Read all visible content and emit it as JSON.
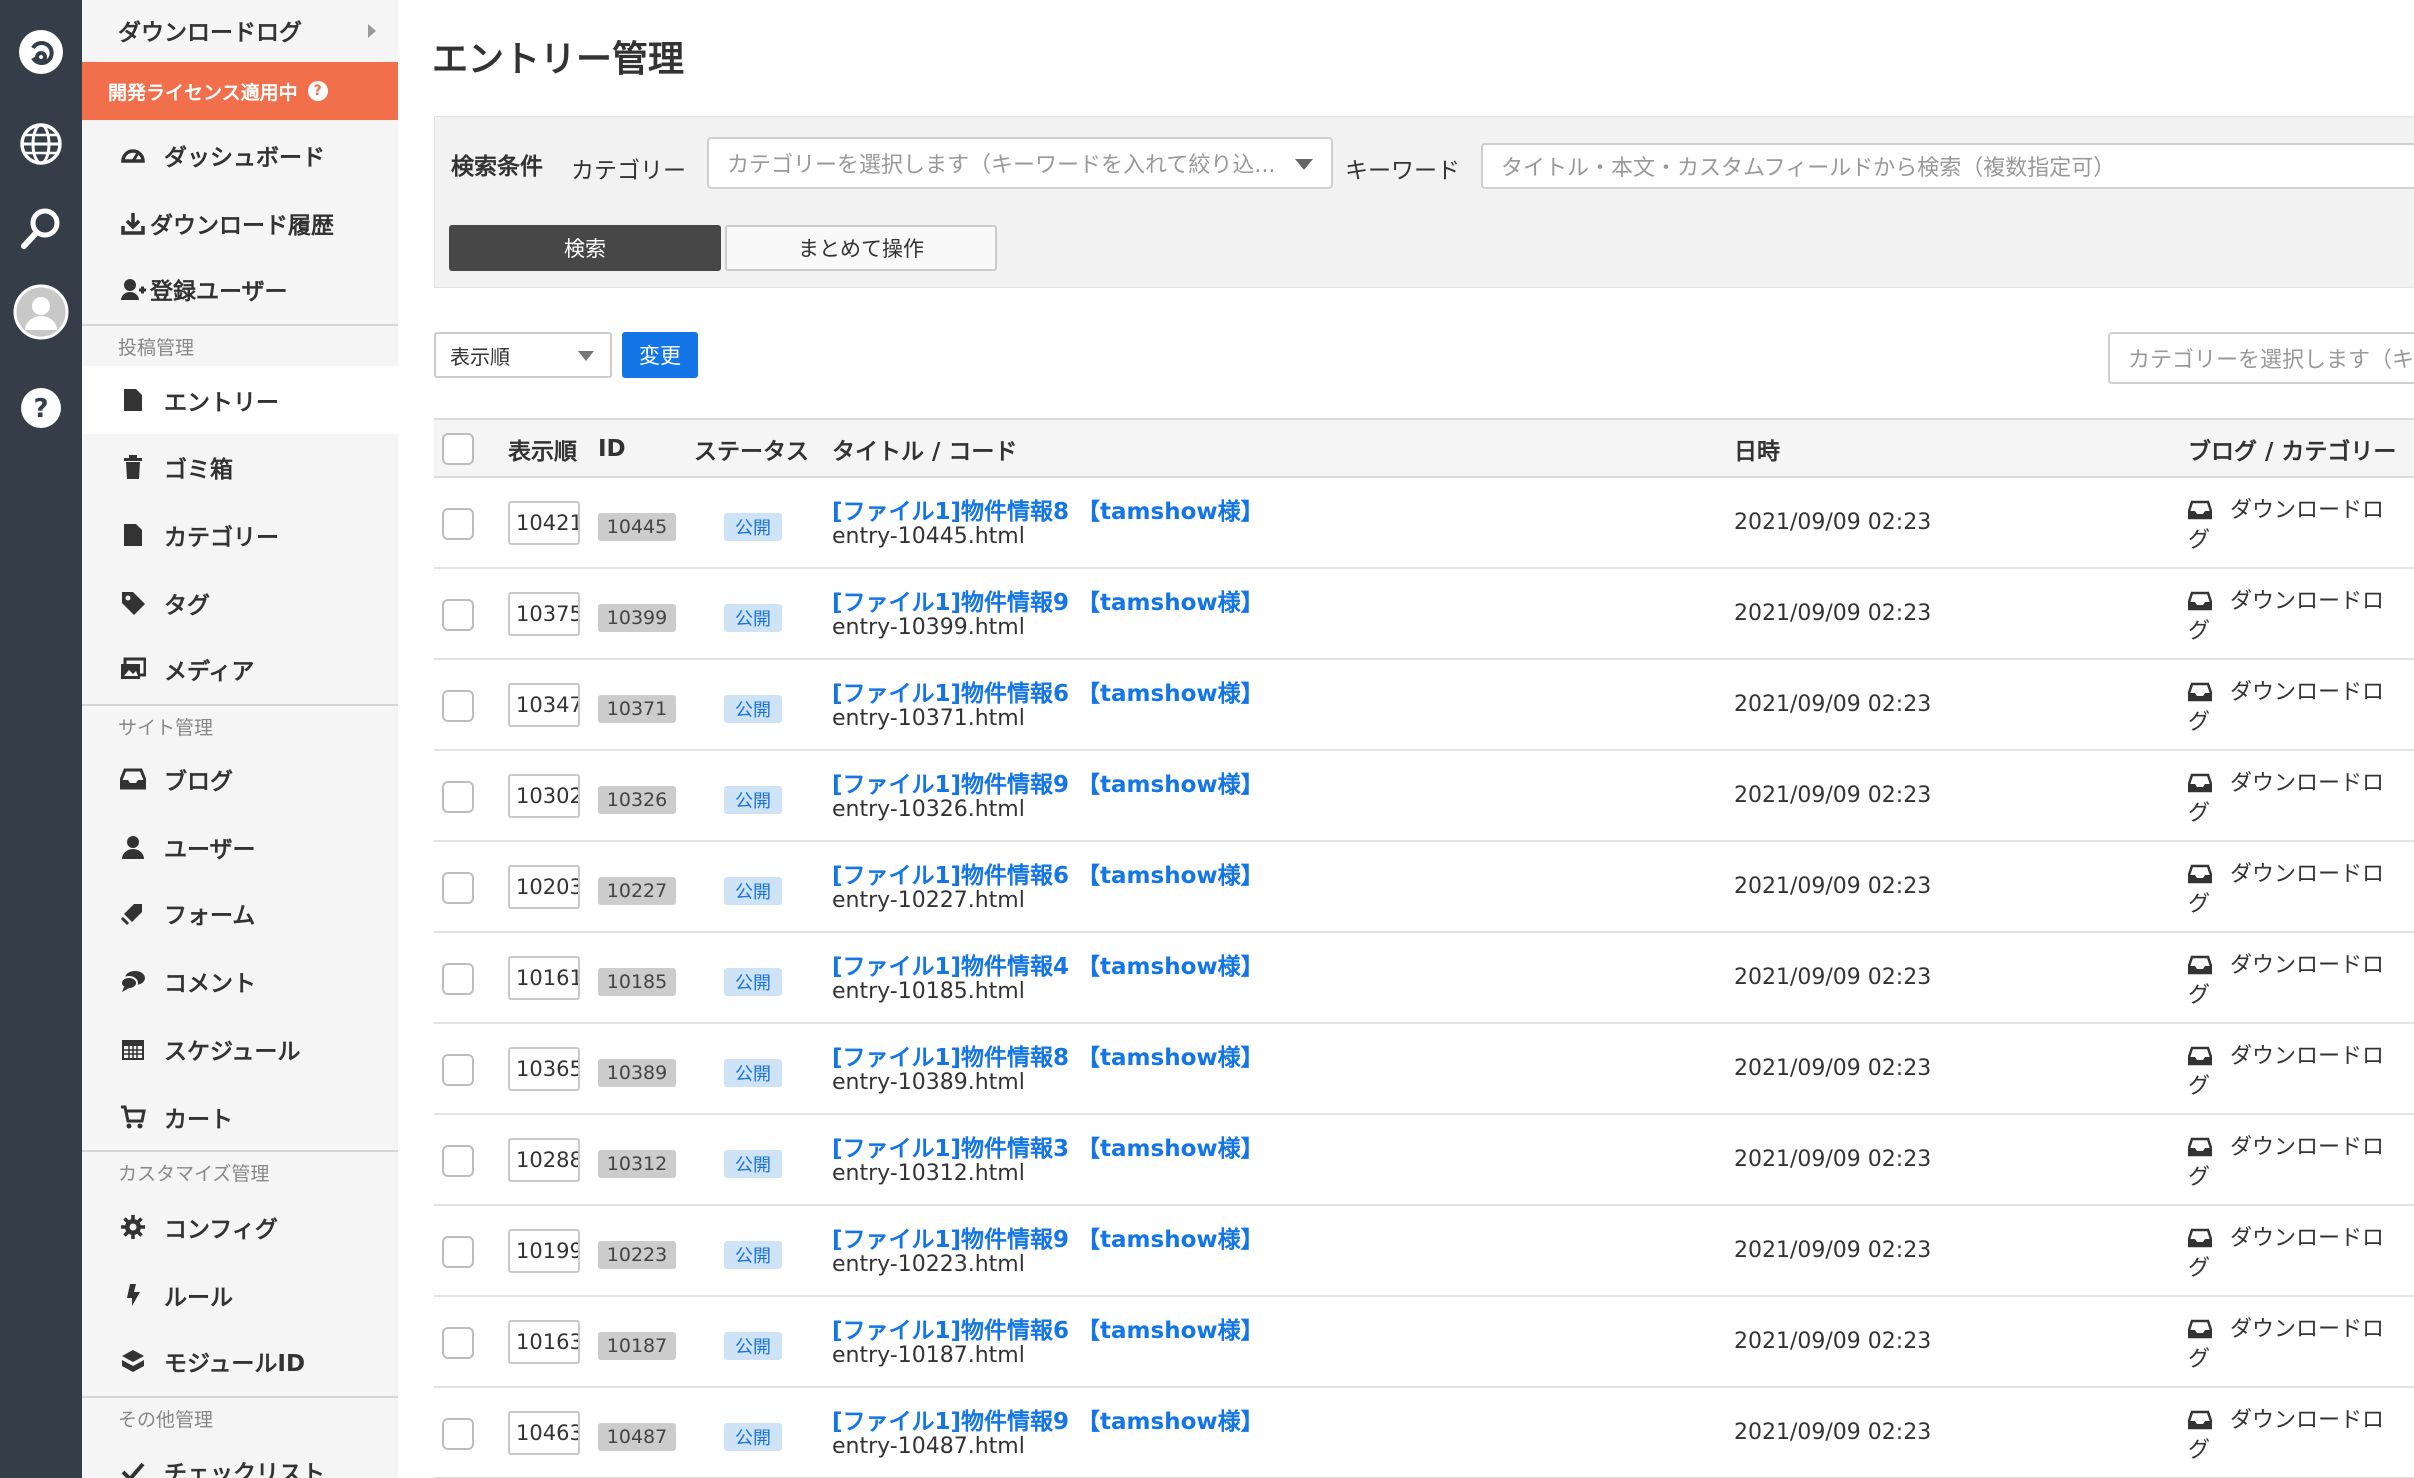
{
  "sidebar": {
    "top_item": "ダウンロードログ",
    "license": "開発ライセンス適用中",
    "license_help": "?",
    "main_items": [
      {
        "label": "ダッシュボード",
        "icon": "dashboard-icon"
      },
      {
        "label": "ダウンロード履歴",
        "icon": "download-icon"
      },
      {
        "label": "登録ユーザー",
        "icon": "user-add-icon"
      }
    ],
    "sections": [
      {
        "title": "投稿管理",
        "items": [
          {
            "label": "エントリー",
            "icon": "document-icon",
            "active": true
          },
          {
            "label": "ゴミ箱",
            "icon": "trash-icon"
          },
          {
            "label": "カテゴリー",
            "icon": "folder-icon"
          },
          {
            "label": "タグ",
            "icon": "tag-icon"
          },
          {
            "label": "メディア",
            "icon": "image-icon"
          }
        ]
      },
      {
        "title": "サイト管理",
        "items": [
          {
            "label": "ブログ",
            "icon": "inbox-icon"
          },
          {
            "label": "ユーザー",
            "icon": "user-icon"
          },
          {
            "label": "フォーム",
            "icon": "form-icon"
          },
          {
            "label": "コメント",
            "icon": "comment-icon"
          },
          {
            "label": "スケジュール",
            "icon": "calendar-icon"
          },
          {
            "label": "カート",
            "icon": "cart-icon"
          }
        ]
      },
      {
        "title": "カスタマイズ管理",
        "items": [
          {
            "label": "コンフィグ",
            "icon": "gear-icon"
          },
          {
            "label": "ルール",
            "icon": "rule-icon"
          },
          {
            "label": "モジュールID",
            "icon": "module-icon"
          }
        ]
      },
      {
        "title": "その他管理",
        "items": [
          {
            "label": "チェックリスト",
            "icon": "check-icon"
          }
        ]
      }
    ]
  },
  "page": {
    "title": "エントリー管理"
  },
  "search": {
    "heading": "検索条件",
    "category_label": "カテゴリー",
    "category_placeholder": "カテゴリーを選択します（キーワードを入れて絞り込...",
    "keyword_label": "キーワード",
    "keyword_placeholder": "タイトル・本文・カスタムフィールドから検索（複数指定可）",
    "search_button": "検索",
    "bulk_button": "まとめて操作"
  },
  "toolbar": {
    "sort_value": "表示順",
    "change_button": "変更",
    "category_filter_placeholder": "カテゴリーを選択します（キ"
  },
  "table": {
    "headers": {
      "order": "表示順",
      "id": "ID",
      "status": "ステータス",
      "title": "タイトル / コード",
      "date": "日時",
      "blog": "ブログ / カテゴリー"
    },
    "rows": [
      {
        "order": "10421",
        "id": "10445",
        "status": "公開",
        "title": "[ファイル1]物件情報8 【tamshow様】",
        "code": "entry-10445.html",
        "date": "2021/09/09 02:23",
        "blog_line1": "ダウンロードロ",
        "blog_line2": "グ"
      },
      {
        "order": "10375",
        "id": "10399",
        "status": "公開",
        "title": "[ファイル1]物件情報9 【tamshow様】",
        "code": "entry-10399.html",
        "date": "2021/09/09 02:23",
        "blog_line1": "ダウンロードロ",
        "blog_line2": "グ"
      },
      {
        "order": "10347",
        "id": "10371",
        "status": "公開",
        "title": "[ファイル1]物件情報6 【tamshow様】",
        "code": "entry-10371.html",
        "date": "2021/09/09 02:23",
        "blog_line1": "ダウンロードロ",
        "blog_line2": "グ"
      },
      {
        "order": "10302",
        "id": "10326",
        "status": "公開",
        "title": "[ファイル1]物件情報9 【tamshow様】",
        "code": "entry-10326.html",
        "date": "2021/09/09 02:23",
        "blog_line1": "ダウンロードロ",
        "blog_line2": "グ"
      },
      {
        "order": "10203",
        "id": "10227",
        "status": "公開",
        "title": "[ファイル1]物件情報6 【tamshow様】",
        "code": "entry-10227.html",
        "date": "2021/09/09 02:23",
        "blog_line1": "ダウンロードロ",
        "blog_line2": "グ"
      },
      {
        "order": "10161",
        "id": "10185",
        "status": "公開",
        "title": "[ファイル1]物件情報4 【tamshow様】",
        "code": "entry-10185.html",
        "date": "2021/09/09 02:23",
        "blog_line1": "ダウンロードロ",
        "blog_line2": "グ"
      },
      {
        "order": "10365",
        "id": "10389",
        "status": "公開",
        "title": "[ファイル1]物件情報8 【tamshow様】",
        "code": "entry-10389.html",
        "date": "2021/09/09 02:23",
        "blog_line1": "ダウンロードロ",
        "blog_line2": "グ"
      },
      {
        "order": "10288",
        "id": "10312",
        "status": "公開",
        "title": "[ファイル1]物件情報3 【tamshow様】",
        "code": "entry-10312.html",
        "date": "2021/09/09 02:23",
        "blog_line1": "ダウンロードロ",
        "blog_line2": "グ"
      },
      {
        "order": "10199",
        "id": "10223",
        "status": "公開",
        "title": "[ファイル1]物件情報9 【tamshow様】",
        "code": "entry-10223.html",
        "date": "2021/09/09 02:23",
        "blog_line1": "ダウンロードロ",
        "blog_line2": "グ"
      },
      {
        "order": "10163",
        "id": "10187",
        "status": "公開",
        "title": "[ファイル1]物件情報6 【tamshow様】",
        "code": "entry-10187.html",
        "date": "2021/09/09 02:23",
        "blog_line1": "ダウンロードロ",
        "blog_line2": "グ"
      },
      {
        "order": "10463",
        "id": "10487",
        "status": "公開",
        "title": "[ファイル1]物件情報9 【tamshow様】",
        "code": "entry-10487.html",
        "date": "2021/09/09 02:23",
        "blog_line1": "ダウンロードロ",
        "blog_line2": "グ"
      }
    ]
  },
  "colors": {
    "rail": "#353d49",
    "license": "#f26f4c",
    "link": "#1476e6",
    "primary_button": "#1476e6"
  }
}
